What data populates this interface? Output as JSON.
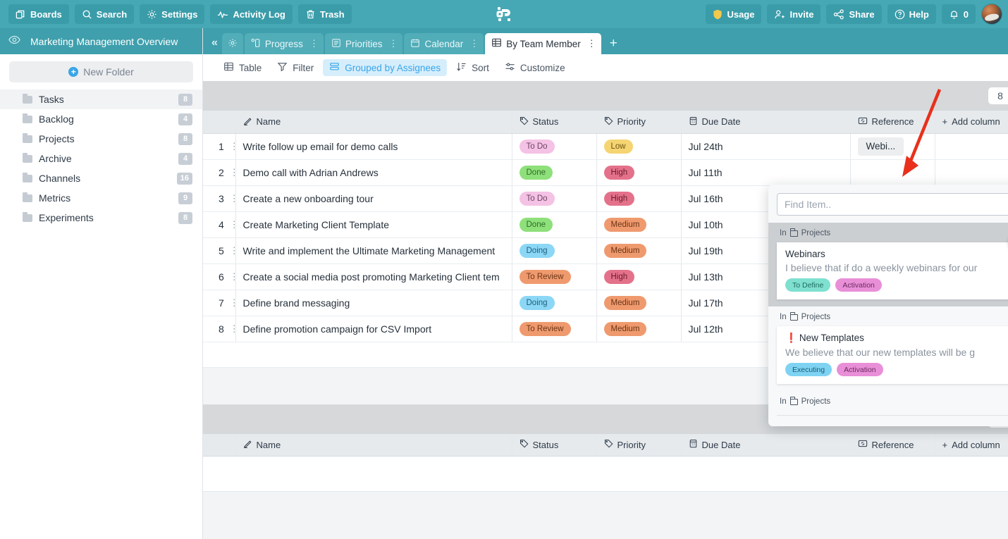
{
  "topbar": {
    "left_buttons": [
      {
        "label": "Boards",
        "icon": "boards-icon"
      },
      {
        "label": "Search",
        "icon": "search-icon"
      },
      {
        "label": "Settings",
        "icon": "gear-icon"
      },
      {
        "label": "Activity Log",
        "icon": "activity-icon"
      },
      {
        "label": "Trash",
        "icon": "trash-icon"
      }
    ],
    "right_buttons": [
      {
        "label": "Usage",
        "icon": "shield-icon"
      },
      {
        "label": "Invite",
        "icon": "user-plus-icon"
      },
      {
        "label": "Share",
        "icon": "share-icon"
      },
      {
        "label": "Help",
        "icon": "question-circle-icon"
      },
      {
        "label": "0",
        "icon": "bell-icon"
      }
    ],
    "logo": "app-logo",
    "accent": "#46a8b4",
    "button_bg": "#3a9ca9",
    "usage_icon_color": "#f2c94c"
  },
  "sidebar": {
    "title": "Marketing Management Overview",
    "eye_icon": "eye-icon",
    "new_folder_label": "New Folder",
    "items": [
      {
        "label": "Tasks",
        "count": "8",
        "active": true
      },
      {
        "label": "Backlog",
        "count": "4",
        "active": false
      },
      {
        "label": "Projects",
        "count": "8",
        "active": false
      },
      {
        "label": "Archive",
        "count": "4",
        "active": false
      },
      {
        "label": "Channels",
        "count": "16",
        "active": false
      },
      {
        "label": "Metrics",
        "count": "9",
        "active": false
      },
      {
        "label": "Experiments",
        "count": "8",
        "active": false
      }
    ]
  },
  "tabs": {
    "collapse_label": "«",
    "items": [
      {
        "label": "",
        "icon": "gear-icon",
        "active": false,
        "kebab": false
      },
      {
        "label": "Progress",
        "icon": "progress-icon",
        "active": false,
        "kebab": true
      },
      {
        "label": "Priorities",
        "icon": "list-icon",
        "active": false,
        "kebab": true
      },
      {
        "label": "Calendar",
        "icon": "calendar-icon",
        "active": false,
        "kebab": true
      },
      {
        "label": "By Team Member",
        "icon": "table-icon",
        "active": true,
        "kebab": true
      }
    ],
    "add_label": "+"
  },
  "toolbar": {
    "items": [
      {
        "label": "Table",
        "icon": "table-icon",
        "active": false
      },
      {
        "label": "Filter",
        "icon": "filter-icon",
        "active": false
      },
      {
        "label": "Grouped by Assignees",
        "icon": "group-icon",
        "active": true
      },
      {
        "label": "Sort",
        "icon": "sort-icon",
        "active": false
      },
      {
        "label": "Customize",
        "icon": "sliders-icon",
        "active": false
      }
    ],
    "active_color": "#3aa5e8"
  },
  "grid": {
    "columns": [
      {
        "label": "Name",
        "icon": "pencil-icon"
      },
      {
        "label": "Status",
        "icon": "tag-icon"
      },
      {
        "label": "Priority",
        "icon": "tag-icon"
      },
      {
        "label": "Due Date",
        "icon": "calendar-icon"
      },
      {
        "label": "Reference",
        "icon": "link-icon"
      }
    ],
    "add_column_label": "Add column"
  },
  "groups": [
    {
      "count": "8",
      "rows": [
        {
          "n": "1",
          "name": "Write follow up email for demo calls",
          "status": "To Do",
          "status_class": "b-todo",
          "priority": "Low",
          "priority_class": "b-low",
          "due": "Jul 24th",
          "reference": "Webi..."
        },
        {
          "n": "2",
          "name": "Demo call with Adrian Andrews",
          "status": "Done",
          "status_class": "b-done",
          "priority": "High",
          "priority_class": "b-high",
          "due": "Jul 11th",
          "reference": ""
        },
        {
          "n": "3",
          "name": "Create a new onboarding tour",
          "status": "To Do",
          "status_class": "b-todo",
          "priority": "High",
          "priority_class": "b-high",
          "due": "Jul 16th",
          "reference": ""
        },
        {
          "n": "4",
          "name": "Create Marketing Client Template",
          "status": "Done",
          "status_class": "b-done",
          "priority": "Medium",
          "priority_class": "b-medium",
          "due": "Jul 10th",
          "reference": ""
        },
        {
          "n": "5",
          "name": "Write and implement the Ultimate Marketing Management",
          "status": "Doing",
          "status_class": "b-doing",
          "priority": "Medium",
          "priority_class": "b-medium",
          "due": "Jul 19th",
          "reference": ""
        },
        {
          "n": "6",
          "name": "Create a social media post promoting Marketing Client tem",
          "status": "To Review",
          "status_class": "b-toreview",
          "priority": "High",
          "priority_class": "b-high",
          "due": "Jul 13th",
          "reference": ""
        },
        {
          "n": "7",
          "name": "Define brand messaging",
          "status": "Doing",
          "status_class": "b-doing",
          "priority": "Medium",
          "priority_class": "b-medium",
          "due": "Jul 17th",
          "reference": ""
        },
        {
          "n": "8",
          "name": "Define promotion campaign for CSV Import",
          "status": "To Review",
          "status_class": "b-toreview",
          "priority": "Medium",
          "priority_class": "b-medium",
          "due": "Jul 12th",
          "reference": ""
        }
      ]
    },
    {
      "count": "0",
      "rows": []
    }
  ],
  "popup": {
    "search_placeholder": "Find Item..",
    "search_value": "",
    "results": [
      {
        "in_label": "In",
        "folder": "Projects",
        "title": "Webinars",
        "bang": "",
        "description": "I believe that if do a weekly webinars for our",
        "tags": [
          {
            "label": "To Define",
            "class": "t-todefine"
          },
          {
            "label": "Activation",
            "class": "t-activation"
          }
        ],
        "highlight": true,
        "link_icon": "link-icon"
      },
      {
        "in_label": "In",
        "folder": "Projects",
        "title": "New Templates",
        "bang": "❗",
        "description": "We believe that our new templates will be g",
        "tags": [
          {
            "label": "Executing",
            "class": "t-executing"
          },
          {
            "label": "Activation",
            "class": "t-activation"
          }
        ],
        "highlight": false,
        "link_icon": ""
      }
    ],
    "trailing_in_label": "In",
    "trailing_folder": "Projects"
  },
  "annotation": {
    "arrow_color": "#e8301c",
    "description": "red-arrow-pointing-to-reference-cell"
  }
}
